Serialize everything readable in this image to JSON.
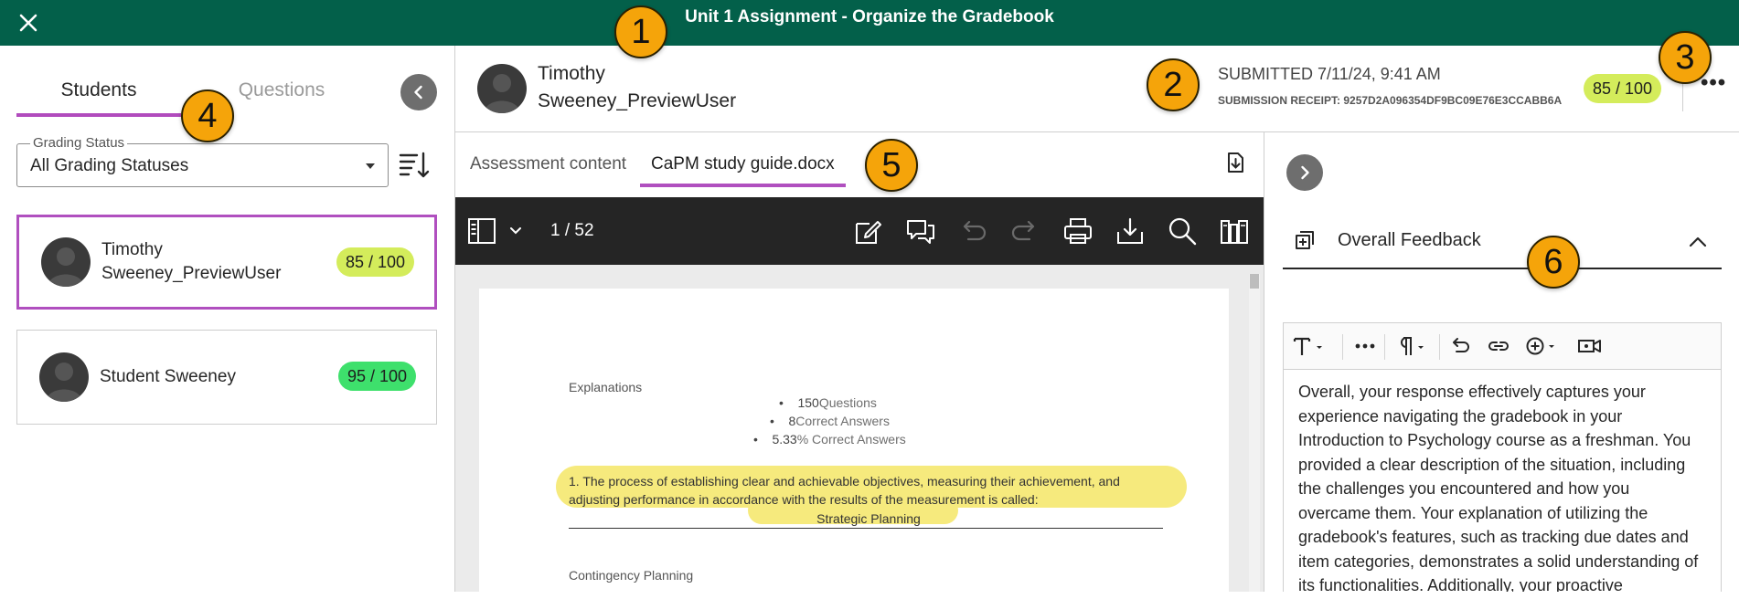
{
  "window": {
    "title": "Unit 1 Assignment - Organize the Gradebook",
    "close_icon": "close-icon"
  },
  "sidebar": {
    "tabs": [
      {
        "label": "Students",
        "active": true
      },
      {
        "label": "Questions",
        "active": false
      }
    ],
    "grading_status": {
      "label": "Grading Status",
      "value": "All Grading Statuses"
    },
    "students": [
      {
        "name_line1": "Timothy",
        "name_line2": "Sweeney_PreviewUser",
        "score": "85 / 100",
        "selected": true,
        "score_color": "#d4ec5b"
      },
      {
        "name_line1": "Student Sweeney",
        "name_line2": "",
        "score": "95 / 100",
        "selected": false,
        "score_color": "#3ee06c"
      }
    ]
  },
  "submission": {
    "name_line1": "Timothy",
    "name_line2": "Sweeney_PreviewUser",
    "submitted": "SUBMITTED 7/11/24, 9:41 AM",
    "receipt": "SUBMISSION RECEIPT: 9257D2A096354DF9BC09E76E3CCABB6A",
    "score": "85 / 100",
    "more": "•••"
  },
  "document": {
    "tabs": [
      {
        "label": "Assessment content",
        "active": false
      },
      {
        "label": "CaPM study guide.docx",
        "active": true
      }
    ],
    "page_indicator": "1 / 52",
    "content": {
      "heading": "Explanations",
      "bullets": [
        {
          "value": "150",
          "label": "Questions"
        },
        {
          "value": "8",
          "label": "Correct Answers"
        },
        {
          "value": "5.33",
          "label": "% Correct Answers"
        }
      ],
      "question_line1": "1. The process of establishing clear and achievable objectives, measuring their achievement, and",
      "question_line2": "adjusting performance in accordance with the results of the measurement is called:",
      "answer": "Strategic Planning",
      "next_heading": "Contingency Planning"
    }
  },
  "feedback": {
    "title": "Overall Feedback",
    "body": "Overall, your response effectively captures your experience navigating the gradebook in your Introduction to Psychology course as a freshman. You provided a clear description of the situation, including the challenges you encountered and how you overcame them. Your explanation of utilizing the gradebook's features, such as tracking due dates and item categories, demonstrates a solid understanding of its functionalities. Additionally, your proactive"
  },
  "callouts": [
    "1",
    "2",
    "3",
    "4",
    "5",
    "6"
  ],
  "colors": {
    "header_bg": "#03604a",
    "accent_purple": "#b04fbf",
    "marker": "#f5a40a",
    "viewer_toolbar": "#252525",
    "highlight": "#f6ea7d"
  }
}
